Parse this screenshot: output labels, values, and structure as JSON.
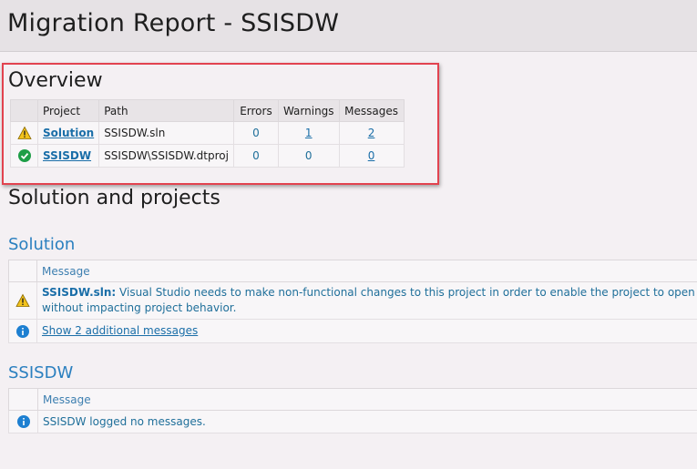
{
  "header": {
    "title": "Migration Report - SSISDW"
  },
  "overview": {
    "title": "Overview",
    "columns": [
      "Project",
      "Path",
      "Errors",
      "Warnings",
      "Messages"
    ],
    "rows": [
      {
        "icon": "warning-icon",
        "project": "Solution",
        "path": "SSISDW.sln",
        "errors": "0",
        "warnings": "1",
        "messages": "2"
      },
      {
        "icon": "success-check-icon",
        "project": "SSISDW",
        "path": "SSISDW\\SSISDW.dtproj",
        "errors": "0",
        "warnings": "0",
        "messages": "0"
      }
    ]
  },
  "section_title": "Solution and projects",
  "solution": {
    "title": "Solution",
    "column": "Message",
    "message_source": "SSISDW.sln:",
    "message_text": " Visual Studio needs to make non-functional changes to this project in order to enable the project to open in re",
    "message_text_2": "without impacting project behavior.",
    "show_more": "Show 2 additional messages"
  },
  "ssisdw": {
    "title": "SSISDW",
    "column": "Message",
    "message": "SSISDW logged no messages."
  },
  "colors": {
    "accent": "#2a7fbf",
    "highlight_border": "#e2434f",
    "warning": "#f2c21b",
    "success": "#1e9e47",
    "info": "#1d7fd1"
  }
}
